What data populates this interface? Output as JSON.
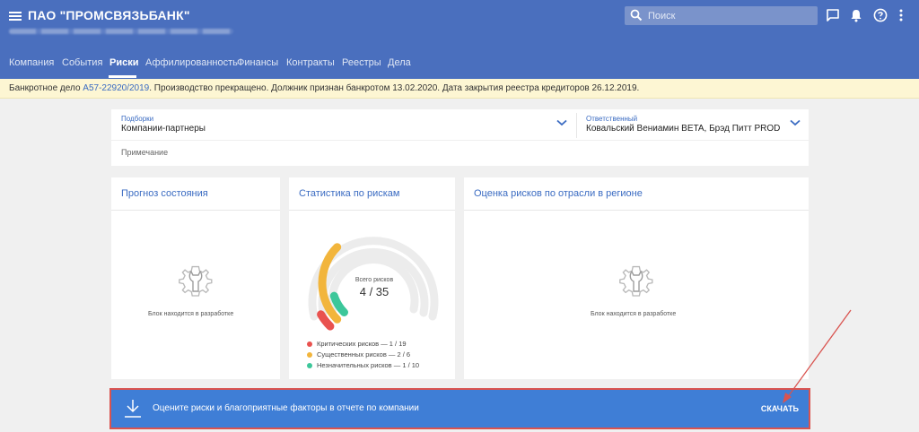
{
  "header": {
    "title": "ПАО \"ПРОМСВЯЗЬБАНК\"",
    "subtitle_blurred": "ИНН 7744000912 · ОГРН 1027739019142 · КПП 772201001",
    "search_placeholder": "Поиск",
    "icons": [
      "menu-icon",
      "search-icon",
      "chat-icon",
      "bell-icon",
      "help-icon",
      "more-vertical-icon"
    ]
  },
  "tabs": [
    {
      "label": "Компания"
    },
    {
      "label": "События"
    },
    {
      "label": "Риски",
      "active": true
    },
    {
      "label": "Аффилированность"
    },
    {
      "label": "Финансы"
    },
    {
      "label": "Контракты"
    },
    {
      "label": "Реестры"
    },
    {
      "label": "Дела"
    }
  ],
  "notice": {
    "prefix": "Банкротное дело ",
    "case_link": "А57-22920/2019",
    "text": ". Производство прекращено. Должник признан банкротом 13.02.2020. Дата закрытия реестра кредиторов 26.12.2019."
  },
  "filters": {
    "selection_label": "Подборки",
    "selection_value": "Компании-партнеры",
    "responsible_label": "Ответственный",
    "responsible_value": "Ковальский Вениамин BETA, Брэд Питт PROD",
    "note_label": "Примечание"
  },
  "panels": {
    "forecast": {
      "title": "Прогноз состояния",
      "dev_text": "Блок находится в разработке"
    },
    "stats": {
      "title": "Статистика по рискам",
      "center_label": "Всего рисков",
      "center_value": "4 / 35",
      "legend": [
        {
          "label": "Критических рисков — 1 / 19",
          "color": "#e9524f",
          "value": 1,
          "total": 19
        },
        {
          "label": "Существенных рисков — 2 / 6",
          "color": "#f2b53c",
          "value": 2,
          "total": 6
        },
        {
          "label": "Незначительных рисков — 1 / 10",
          "color": "#3cc79a",
          "value": 1,
          "total": 10
        }
      ]
    },
    "industry": {
      "title": "Оценка рисков по отрасли в регионе",
      "dev_text": "Блок находится в разработке"
    }
  },
  "banner": {
    "text": "Оцените риски и благоприятные факторы в отчете по компании",
    "button": "СКАЧАТЬ"
  },
  "colors": {
    "header": "#4a6fbe",
    "accent": "#3a6bc2",
    "banner": "#3f7ed6",
    "annotation": "#d9534f"
  }
}
